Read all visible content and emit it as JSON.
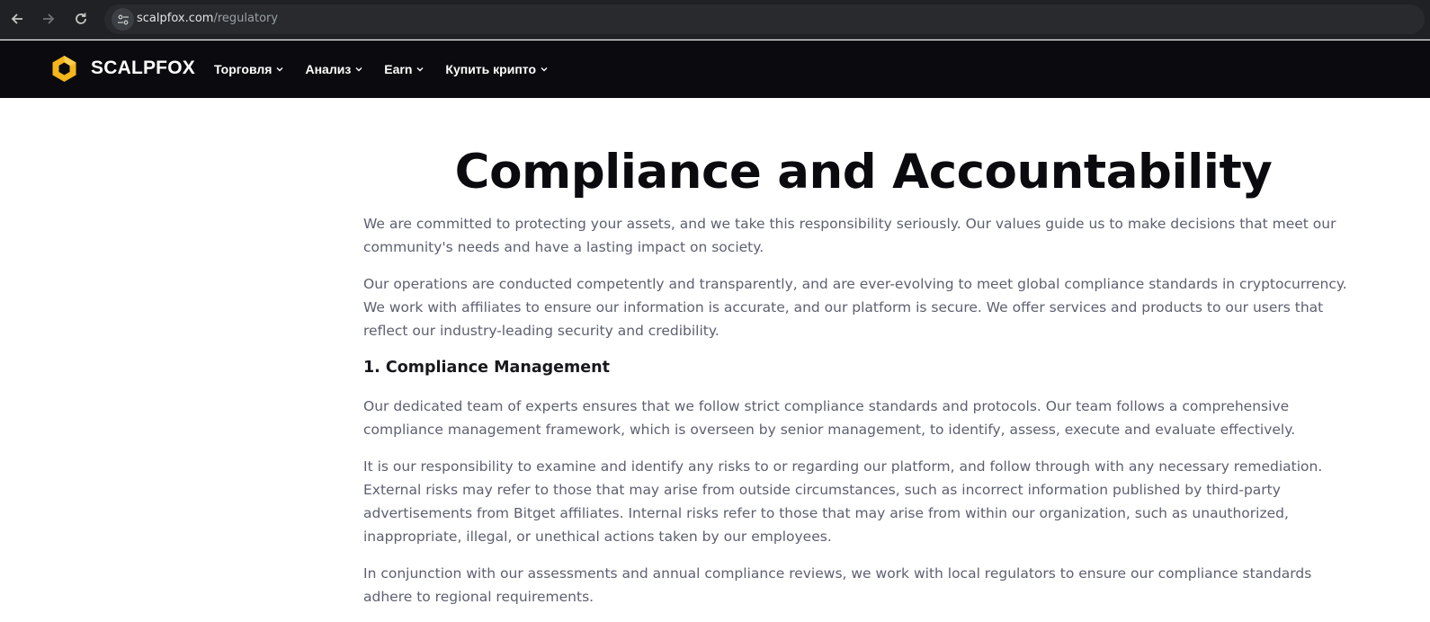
{
  "browser": {
    "url_host": "scalpfox.com",
    "url_path": "/regulatory"
  },
  "header": {
    "logo_text": "SCALPFOX",
    "menu": [
      {
        "label": "Торговля"
      },
      {
        "label": "Анализ"
      },
      {
        "label": "Earn"
      },
      {
        "label": "Купить крипто"
      }
    ]
  },
  "colors": {
    "brand": "#f5b51b",
    "header_bg": "#0b0b0f",
    "text_body": "#5d6070"
  },
  "main": {
    "title": "Compliance and Accountability",
    "intro_paragraphs": [
      "We are committed to protecting your assets, and we take this responsibility seriously. Our values guide us to make decisions that meet our community's needs and have a lasting impact on society.",
      "Our operations are conducted competently and transparently, and are ever-evolving to meet global compliance standards in cryptocurrency. We work with affiliates to ensure our information is accurate, and our platform is secure. We offer services and products to our users that reflect our industry-leading security and credibility."
    ],
    "section_1_heading": "1. Compliance Management",
    "section_1_paragraphs": [
      "Our dedicated team of experts ensures that we follow strict compliance standards and protocols. Our team follows a comprehensive compliance management framework, which is overseen by senior management, to identify, assess, execute and evaluate effectively.",
      "It is our responsibility to examine and identify any risks to or regarding our platform, and follow through with any necessary remediation. External risks may refer to those that may arise from outside circumstances, such as incorrect information published by third-party advertisements from Bitget affiliates. Internal risks refer to those that may arise from within our organization, such as unauthorized, inappropriate, illegal, or unethical actions taken by our employees.",
      "In conjunction with our assessments and annual compliance reviews, we work with local regulators to ensure our compliance standards adhere to regional requirements."
    ]
  }
}
